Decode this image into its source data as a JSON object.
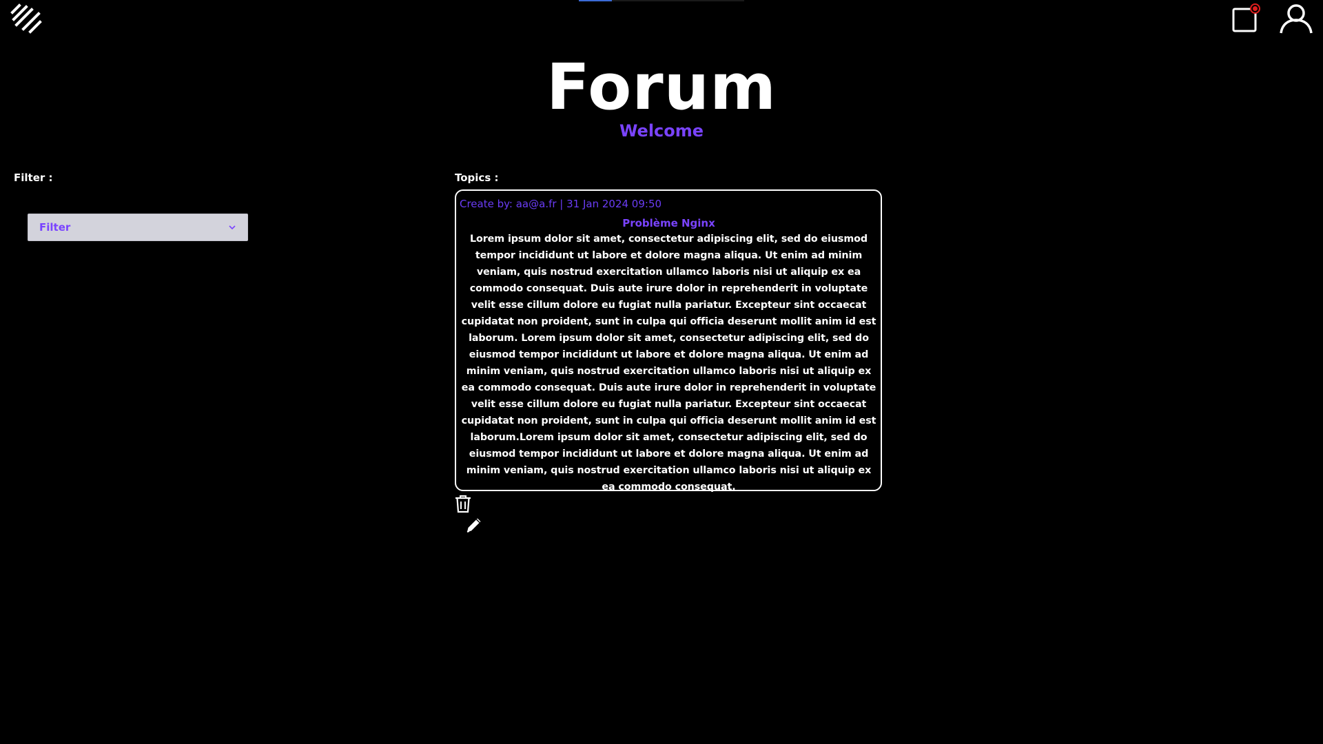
{
  "header": {
    "logo_icon": "stacked-slashes-logo",
    "notification_icon": "notification-bell-icon",
    "notification_badge_color": "#e01e1e",
    "user_icon": "user-account-icon",
    "progress": 0.2
  },
  "page": {
    "title": "Forum",
    "subtitle": "Welcome",
    "accent_color": "#7a43ff"
  },
  "filter": {
    "label": "Filter :",
    "selected": "Filter"
  },
  "topics": {
    "label": "Topics :",
    "items": [
      {
        "meta": "Create by: aa@a.fr | 31 Jan 2024 09:50",
        "title": "Problème Nginx",
        "body": "Lorem ipsum dolor sit amet, consectetur adipiscing elit, sed do eiusmod tempor incididunt ut labore et dolore magna aliqua. Ut enim ad minim veniam, quis nostrud exercitation ullamco laboris nisi ut aliquip ex ea commodo consequat. Duis aute irure dolor in reprehenderit in voluptate velit esse cillum dolore eu fugiat nulla pariatur. Excepteur sint occaecat cupidatat non proident, sunt in culpa qui officia deserunt mollit anim id est laborum. Lorem ipsum dolor sit amet, consectetur adipiscing elit, sed do eiusmod tempor incididunt ut labore et dolore magna aliqua. Ut enim ad minim veniam, quis nostrud exercitation ullamco laboris nisi ut aliquip ex ea commodo consequat. Duis aute irure dolor in reprehenderit in voluptate velit esse cillum dolore eu fugiat nulla pariatur. Excepteur sint occaecat cupidatat non proident, sunt in culpa qui officia deserunt mollit anim id est laborum.Lorem ipsum dolor sit amet, consectetur adipiscing elit, sed do eiusmod tempor incididunt ut labore et dolore magna aliqua. Ut enim ad minim veniam, quis nostrud exercitation ullamco laboris nisi ut aliquip ex ea commodo consequat.",
        "delete_icon": "trash-icon",
        "edit_icon": "pencil-icon"
      }
    ]
  }
}
